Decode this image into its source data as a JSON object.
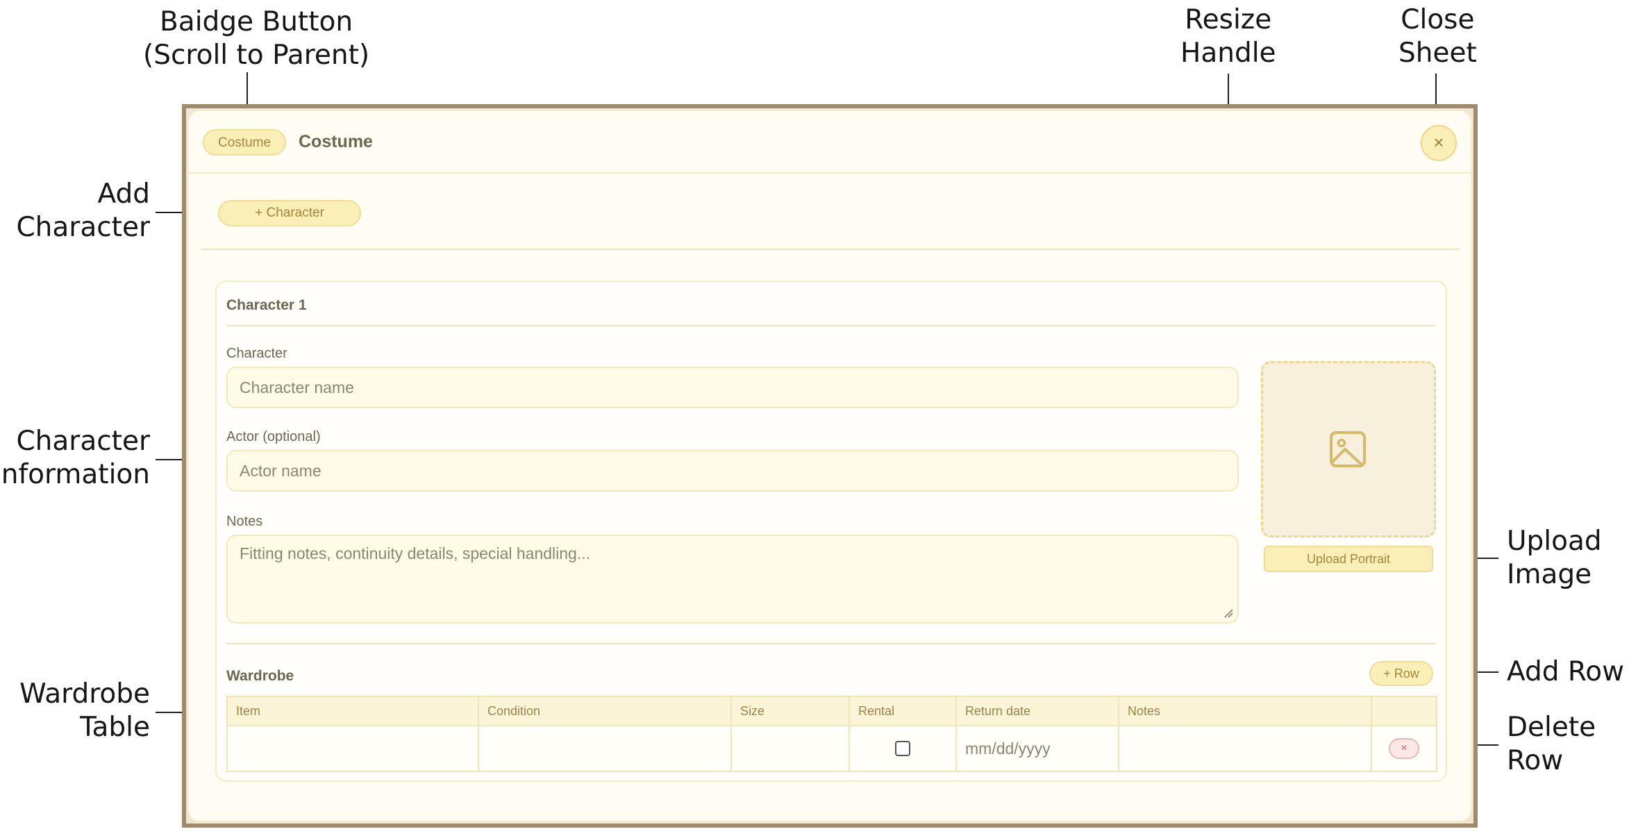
{
  "annotations": {
    "badge_button": [
      "Baidge Button",
      "(Scroll to Parent)"
    ],
    "resize_handle": [
      "Resize",
      "Handle"
    ],
    "close_sheet": [
      "Close",
      "Sheet"
    ],
    "add_character": [
      "Add",
      "Character"
    ],
    "character_information": [
      "Character",
      "Information"
    ],
    "upload_image": [
      "Upload",
      "Image"
    ],
    "add_row": [
      "Add Row"
    ],
    "wardrobe_table": [
      "Wardrobe",
      "Table"
    ],
    "delete_row": [
      "Delete",
      "Row"
    ]
  },
  "sheet": {
    "badge_label": "Costume",
    "title": "Costume",
    "close_icon": "×",
    "add_character_label": "+ Character"
  },
  "character": {
    "heading": "Character 1",
    "character_label": "Character",
    "character_placeholder": "Character name",
    "actor_label": "Actor (optional)",
    "actor_placeholder": "Actor name",
    "notes_label": "Notes",
    "notes_placeholder": "Fitting notes, continuity details, special handling...",
    "upload_label": "Upload Portrait",
    "portrait_icon": "image-icon"
  },
  "wardrobe": {
    "heading": "Wardrobe",
    "add_row_label": "+ Row",
    "columns": [
      "Item",
      "Condition",
      "Size",
      "Rental",
      "Return date",
      "Notes",
      ""
    ],
    "rows": [
      {
        "item": "",
        "condition": "",
        "size": "",
        "rental": false,
        "return_date_placeholder": "mm/dd/yyyy",
        "notes": "",
        "delete_icon": "×"
      }
    ]
  },
  "colors": {
    "accent": "#fbefb8",
    "accent_border": "#f0dd93",
    "accent_text": "#a3863a",
    "frame": "#a08a6b",
    "danger": "#c65a5a"
  }
}
